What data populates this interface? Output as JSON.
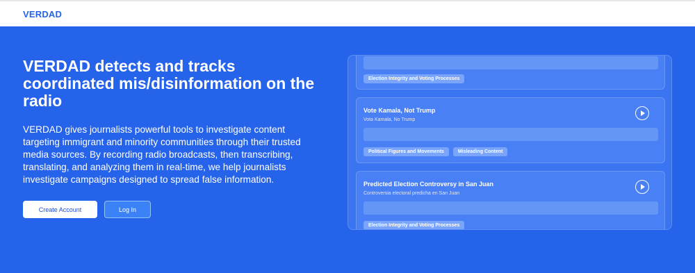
{
  "brand": {
    "name": "VERDAD"
  },
  "hero": {
    "headline": "VERDAD detects and tracks coordinated mis/disinformation on the radio",
    "description": "VERDAD gives journalists powerful tools to investigate content targeting immigrant and minority communities through their trusted media sources. By recording radio broadcasts, then transcribing, translating, and analyzing them in real-time, we help journalists investigate campaigns designed to spread false information.",
    "create_account": "Create Account",
    "log_in": "Log In"
  },
  "cards": [
    {
      "title": "",
      "subtitle": "",
      "tags": [
        "Election Integrity and Voting Processes"
      ]
    },
    {
      "title": "Vote Kamala, Not Trump",
      "subtitle": "Vota Kamala, No Trump",
      "tags": [
        "Political Figures and Movements",
        "Misleading Content"
      ]
    },
    {
      "title": "Predicted Election Controversy in San Juan",
      "subtitle": "Controversia electoral predicha en San Juan",
      "tags": [
        "Election Integrity and Voting Processes"
      ]
    }
  ],
  "icons": {
    "play": "play-circle-icon"
  },
  "colors": {
    "accent": "#2563eb",
    "white": "#ffffff"
  }
}
